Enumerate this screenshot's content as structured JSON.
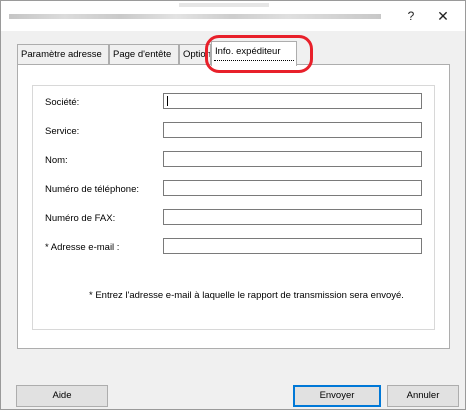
{
  "window": {
    "help_glyph": "?",
    "close_glyph": "✕"
  },
  "tabs": [
    {
      "label": "Paramètre adresse"
    },
    {
      "label": "Page d'entête"
    },
    {
      "label": "Options"
    },
    {
      "label": "Info. expéditeur"
    }
  ],
  "active_tab": "Info. expéditeur",
  "form": {
    "fields": [
      {
        "label": "Société:",
        "value": ""
      },
      {
        "label": "Service:",
        "value": ""
      },
      {
        "label": "Nom:",
        "value": ""
      },
      {
        "label": "Numéro de téléphone:",
        "value": ""
      },
      {
        "label": "Numéro de FAX:",
        "value": ""
      },
      {
        "label": "* Adresse e-mail :",
        "value": ""
      }
    ],
    "note": "* Entrez l'adresse e-mail à laquelle le rapport de transmission sera envoyé."
  },
  "buttons": {
    "help": "Aide",
    "send": "Envoyer",
    "cancel": "Annuler"
  },
  "colors": {
    "highlight": "#e8202a",
    "focus_border": "#0078d7",
    "dialog_bg": "#f0f0f0"
  }
}
